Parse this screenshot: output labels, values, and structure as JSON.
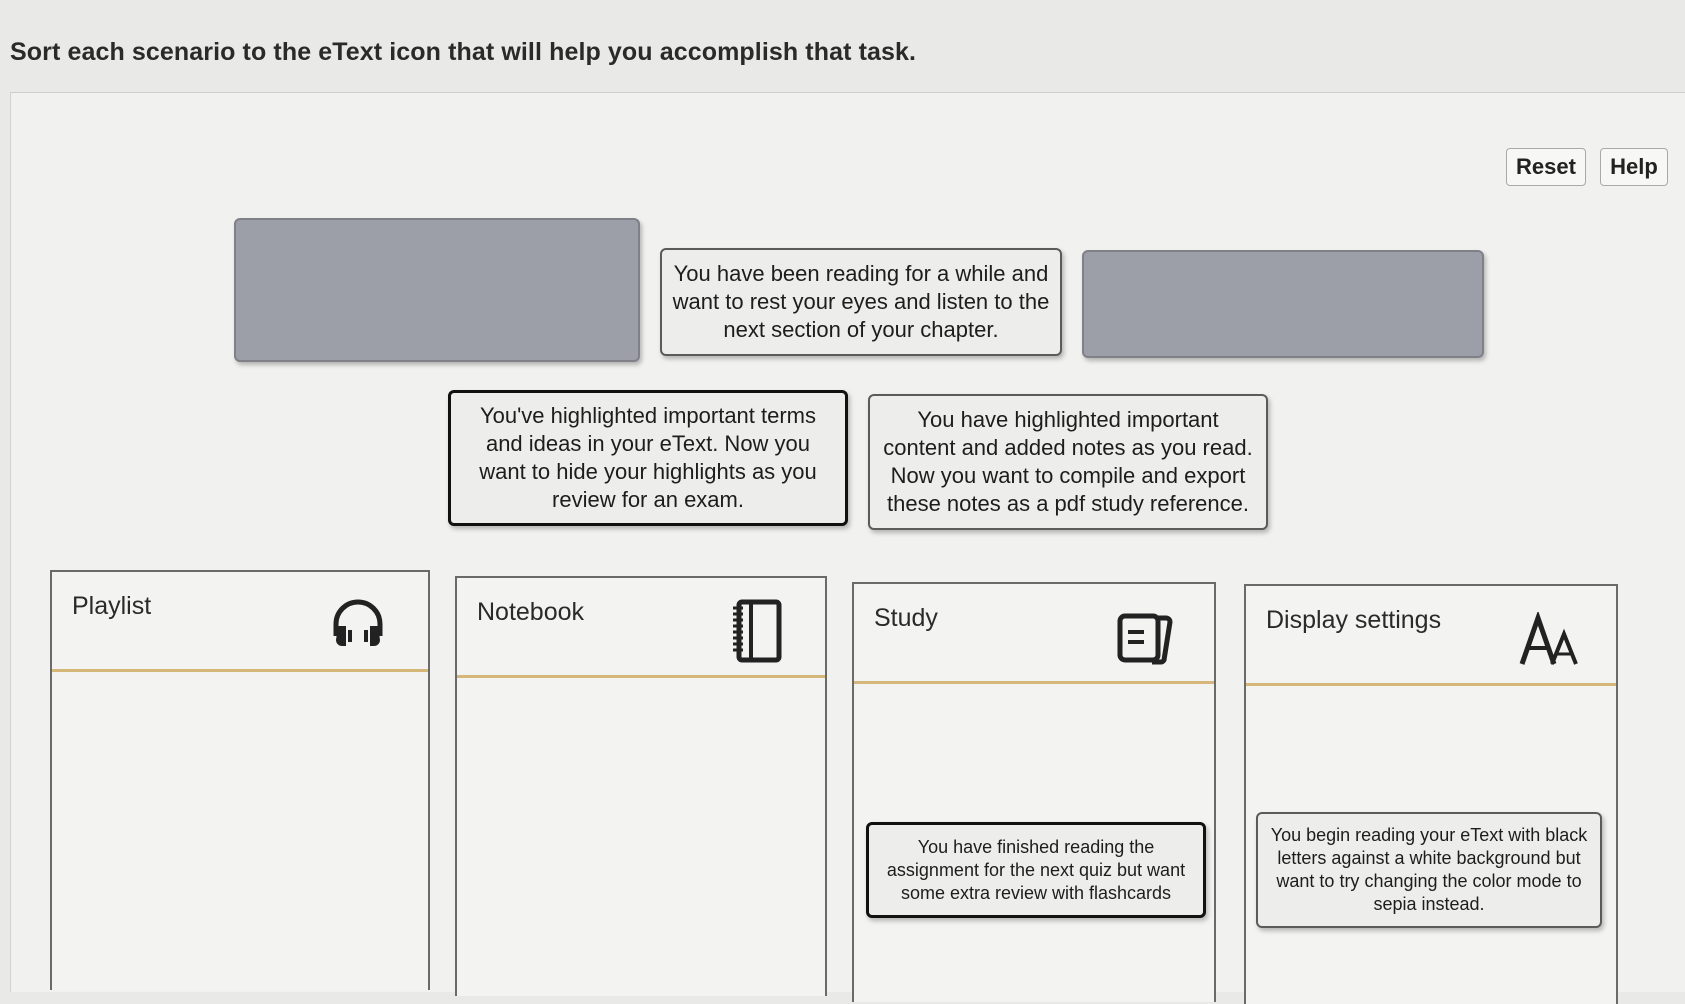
{
  "instruction": "Sort each scenario to the eText icon that will help you accomplish that task.",
  "toolbar": {
    "reset_label": "Reset",
    "help_label": "Help"
  },
  "cards": {
    "listen": "You have been reading for a while and want to rest your eyes and listen to the next section of your chapter.",
    "hide_highlights": "You've highlighted important terms and ideas in your eText. Now you want to hide your highlights as you review for an exam.",
    "export_notes": "You have highlighted important content and added notes as you read. Now you want to compile and export these notes as a pdf study reference."
  },
  "buckets": [
    {
      "label": "Playlist",
      "icon": "headphones-icon"
    },
    {
      "label": "Notebook",
      "icon": "notebook-icon"
    },
    {
      "label": "Study",
      "icon": "flashcards-icon",
      "placed": "You have finished reading the assignment for the next quiz but want some extra review with flashcards"
    },
    {
      "label": "Display settings",
      "icon": "text-size-icon",
      "placed": "You begin reading your eText with black letters against a white background but want to try changing the color mode to sepia instead."
    }
  ]
}
